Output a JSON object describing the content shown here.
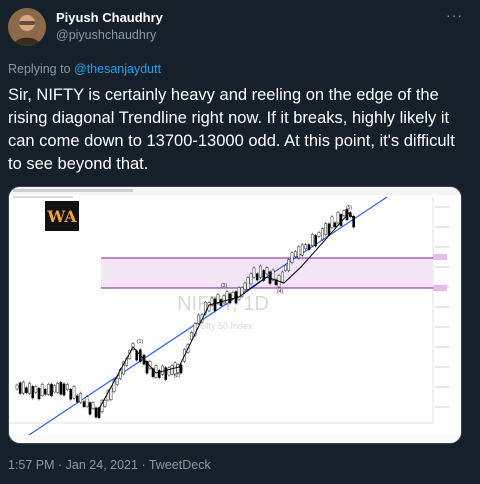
{
  "tweet": {
    "author_name": "Piyush Chaudhry",
    "author_handle": "@piyushchaudhry",
    "replying_prefix": "Replying to ",
    "replying_to": "@thesanjaydutt",
    "text": "Sir, NIFTY is certainly heavy and reeling on the edge of the rising diagonal Trendline right now. If it breaks, highly likely it can come down to 13700-13000 odd. At this point, it's difficult to see beyond that.",
    "time": "1:57 PM",
    "separator": " · ",
    "date": "Jan 24, 2021",
    "source": "TweetDeck",
    "more_icon": "more-horizontal-icon"
  },
  "chart_image": {
    "watermark_title": "NIFTY, 1D",
    "watermark_subtitle": "Nifty 50 Index",
    "logo_text": "WA",
    "wave_labels": [
      "(1)",
      "(2)",
      "(3)",
      "(4)",
      "(5)"
    ],
    "colors": {
      "trendline": "#2962ff",
      "zone_border": "#7b1fa2",
      "zone_fill": "#f3e5f5",
      "candle_up": "#ffffff",
      "candle_down": "#000000",
      "wave_line": "#000000"
    }
  }
}
